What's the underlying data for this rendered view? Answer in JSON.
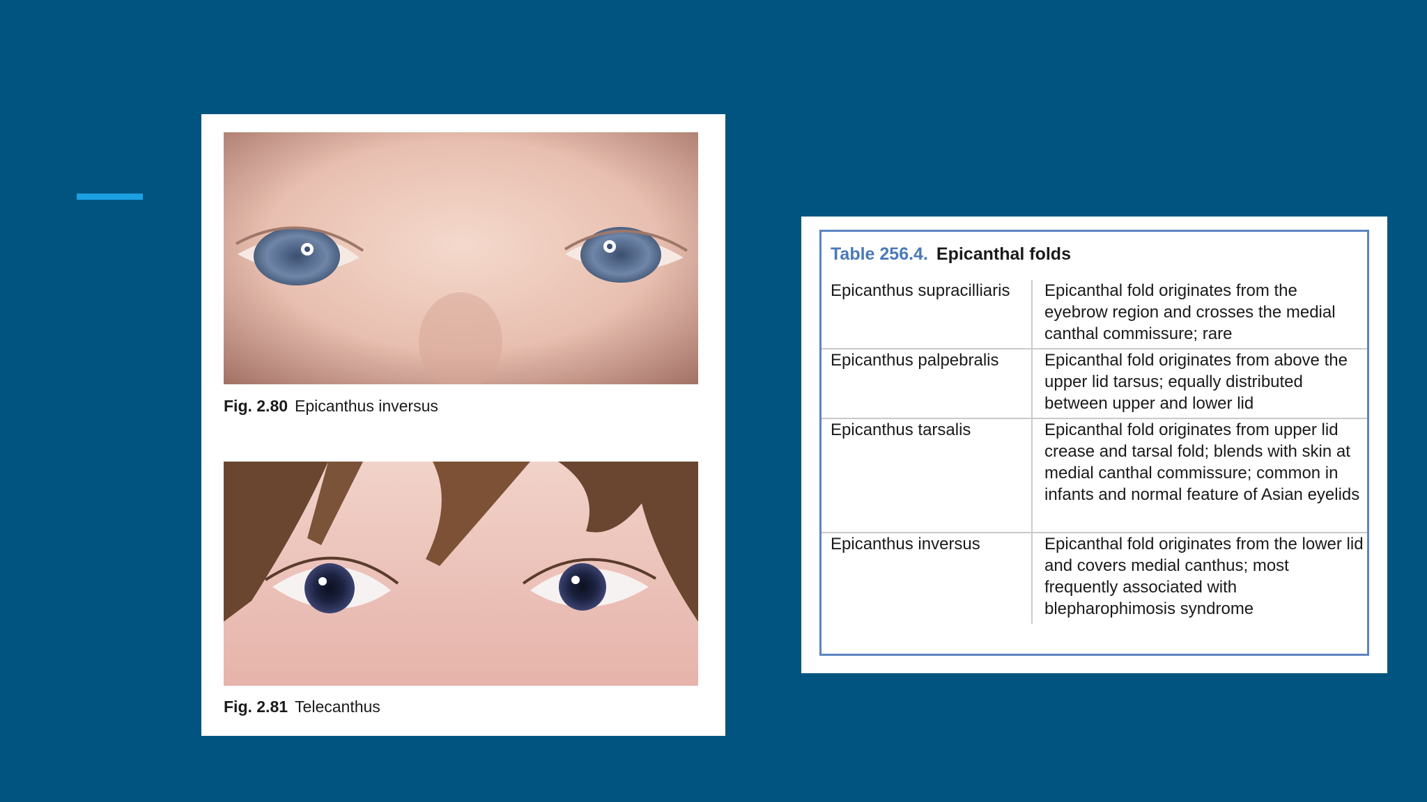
{
  "figures": [
    {
      "number": "Fig. 2.80",
      "title": "Epicanthus inversus"
    },
    {
      "number": "Fig. 2.81",
      "title": "Telecanthus"
    }
  ],
  "table": {
    "number": "Table 256.4.",
    "title": "Epicanthal folds",
    "rows": [
      {
        "term": "Epicanthus supracilliaris",
        "description": "Epicanthal fold originates from the eyebrow region and crosses the medial canthal commissure; rare"
      },
      {
        "term": "Epicanthus palpebralis",
        "description": "Epicanthal fold originates from above the upper lid tarsus; equally distributed between upper and lower lid"
      },
      {
        "term": "Epicanthus tarsalis",
        "description": "Epicanthal fold originates from upper lid crease and tarsal fold; blends with skin at medial canthal commissure; common in infants and normal feature of Asian eyelids"
      },
      {
        "term": "Epicanthus inversus",
        "description": "Epicanthal fold originates from the lower lid and covers medial canthus; most frequently associated with blepharophimosis syndrome"
      }
    ]
  },
  "colors": {
    "background": "#00547f",
    "accent": "#1ba0e2",
    "table_border": "#5b84c1",
    "table_number": "#4a78b9"
  }
}
